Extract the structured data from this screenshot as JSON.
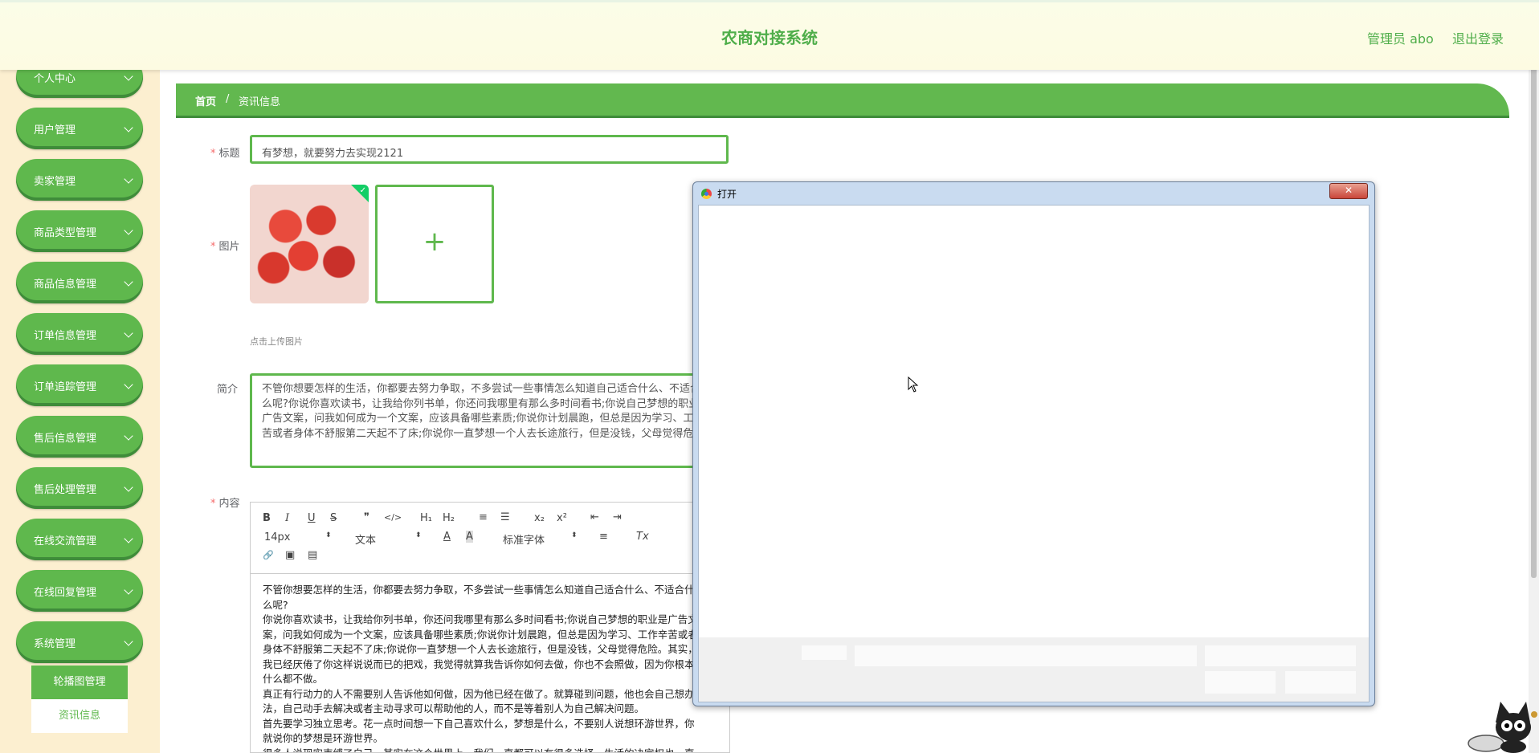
{
  "header": {
    "title": "农商对接系统",
    "user_label": "管理员 abo",
    "logout_label": "退出登录"
  },
  "sidebar": {
    "items": [
      {
        "label": "个人中心"
      },
      {
        "label": "用户管理"
      },
      {
        "label": "卖家管理"
      },
      {
        "label": "商品类型管理"
      },
      {
        "label": "商品信息管理"
      },
      {
        "label": "订单信息管理"
      },
      {
        "label": "订单追踪管理"
      },
      {
        "label": "售后信息管理"
      },
      {
        "label": "售后处理管理"
      },
      {
        "label": "在线交流管理"
      },
      {
        "label": "在线回复管理"
      },
      {
        "label": "系统管理"
      }
    ],
    "subitems": [
      {
        "label": "轮播图管理"
      },
      {
        "label": "资讯信息"
      }
    ]
  },
  "breadcrumb": {
    "home": "首页",
    "separator": "/",
    "current": "资讯信息"
  },
  "form": {
    "required_mark": "*",
    "title_label": "标题",
    "title_value": "有梦想，就要努力去实现2121",
    "image_label": "图片",
    "upload_plus": "+",
    "upload_hint": "点击上传图片",
    "intro_label": "简介",
    "intro_value": "不管你想要怎样的生活，你都要去努力争取，不多尝试一些事情怎么知道自己适合什么、不适合什么呢?你说你喜欢读书，让我给你列书单，你还问我哪里有那么多时间看书;你说自己梦想的职业是广告文案，问我如何成为一个文案，应该具备哪些素质;你说你计划晨跑，但总是因为学习、工作辛苦或者身体不舒服第二天起不了床;你说你一直梦想一个人去长途旅行，但是没钱，父母觉得危险。",
    "content_label": "内容"
  },
  "editor": {
    "toolbar": {
      "bold": "B",
      "italic": "I",
      "underline": "U",
      "strike": "S",
      "quote": "❞",
      "code": "</>",
      "h1": "H₁",
      "h2": "H₂",
      "ol": "≡",
      "ul": "☰",
      "sub": "x₂",
      "sup": "x²",
      "outdent": "⇤",
      "indent": "⇥",
      "size": "14px",
      "header_select": "文本",
      "font_select": "标准字体",
      "color": "A",
      "background": "A",
      "align": "≡",
      "clean": "Tx",
      "link": "🔗",
      "image": "▣",
      "video": "▤"
    },
    "content_lines": [
      "不管你想要怎样的生活，你都要去努力争取，不多尝试一些事情怎么知道自己适合什么、不适合什",
      "么呢?",
      "你说你喜欢读书，让我给你列书单，你还问我哪里有那么多时间看书;你说自己梦想的职业是广告文",
      "案，问我如何成为一个文案，应该具备哪些素质;你说你计划晨跑，但总是因为学习、工作辛苦或者",
      "身体不舒服第二天起不了床;你说你一直梦想一个人去长途旅行，但是没钱，父母觉得危险。其实，",
      "我已经厌倦了你这样说说而已的把戏，我觉得就算我告诉你如何去做，你也不会照做，因为你根本",
      "什么都不做。",
      "真正有行动力的人不需要别人告诉他如何做，因为他已经在做了。就算碰到问题，他也会自己想办",
      "法，自己动手去解决或者主动寻求可以帮助他的人，而不是等着别人为自己解决问题。",
      "首先要学习独立思考。花一点时间想一下自己喜欢什么，梦想是什么，不要别人说想环游世界，你",
      "就说你的梦想是环游世界。",
      "很多人说现实束缚了自己，其实在这个世界上，我们一直都可以有很多选择，生活的决定权也一直"
    ]
  },
  "dialog": {
    "title": "打开",
    "close": "✕"
  },
  "colors": {
    "accent": "#5fb84d",
    "sidebar_bg": "#fcefd0",
    "header_text": "#4fae4a"
  }
}
